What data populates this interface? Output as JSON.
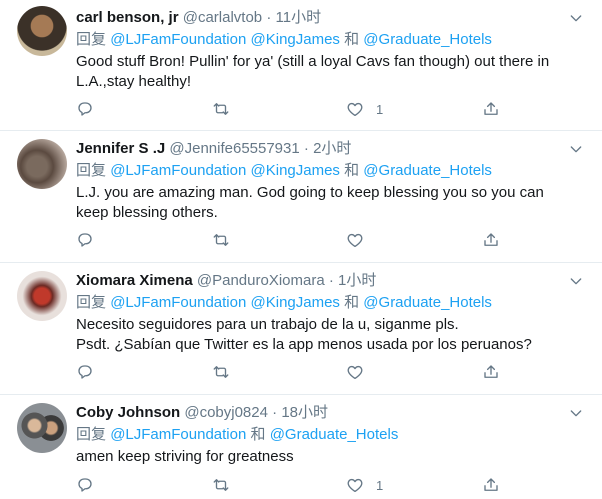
{
  "tweets": [
    {
      "name": "carl benson, jr",
      "handle": "@carlalvtob",
      "time": "11小时",
      "reply_label": "回复",
      "mention1": "@LJFamFoundation",
      "mention2": "@KingJames",
      "conj": "和",
      "mention3": "@Graduate_Hotels",
      "text": "Good stuff Bron! Pullin' for ya' (still a loyal Cavs fan though) out there in L.A.,stay healthy!",
      "like_count": "1"
    },
    {
      "name": "Jennifer S .J",
      "handle": "@Jennife65557931",
      "time": "2小时",
      "reply_label": "回复",
      "mention1": "@LJFamFoundation",
      "mention2": "@KingJames",
      "conj": "和",
      "mention3": "@Graduate_Hotels",
      "text": "L.J. you are amazing man. God going to keep blessing you so you can keep blessing others.",
      "like_count": ""
    },
    {
      "name": "Xiomara Ximena",
      "handle": "@PanduroXiomara",
      "time": "1小时",
      "reply_label": "回复",
      "mention1": "@LJFamFoundation",
      "mention2": "@KingJames",
      "conj": "和",
      "mention3": "@Graduate_Hotels",
      "text_line1": "Necesito seguidores para un trabajo de la u, siganme pls.",
      "text_line2": "Psdt. ¿Sabían que Twitter es la app menos usada por los peruanos?",
      "like_count": ""
    },
    {
      "name": "Coby Johnson",
      "handle": "@cobyj0824",
      "time": "18小时",
      "reply_label": "回复",
      "mention1": "@LJFamFoundation",
      "conj": "和",
      "mention3": "@Graduate_Hotels",
      "text": "amen keep striving for greatness",
      "like_count": "1"
    }
  ],
  "separator": " · ",
  "icons": {
    "reply": "reply-icon",
    "retweet": "retweet-icon",
    "like": "heart-icon",
    "share": "share-icon",
    "more": "chevron-down-icon"
  },
  "colors": {
    "link": "#1da1f2",
    "muted": "#657786",
    "text": "#14171a",
    "divider": "#e6ecf0"
  }
}
